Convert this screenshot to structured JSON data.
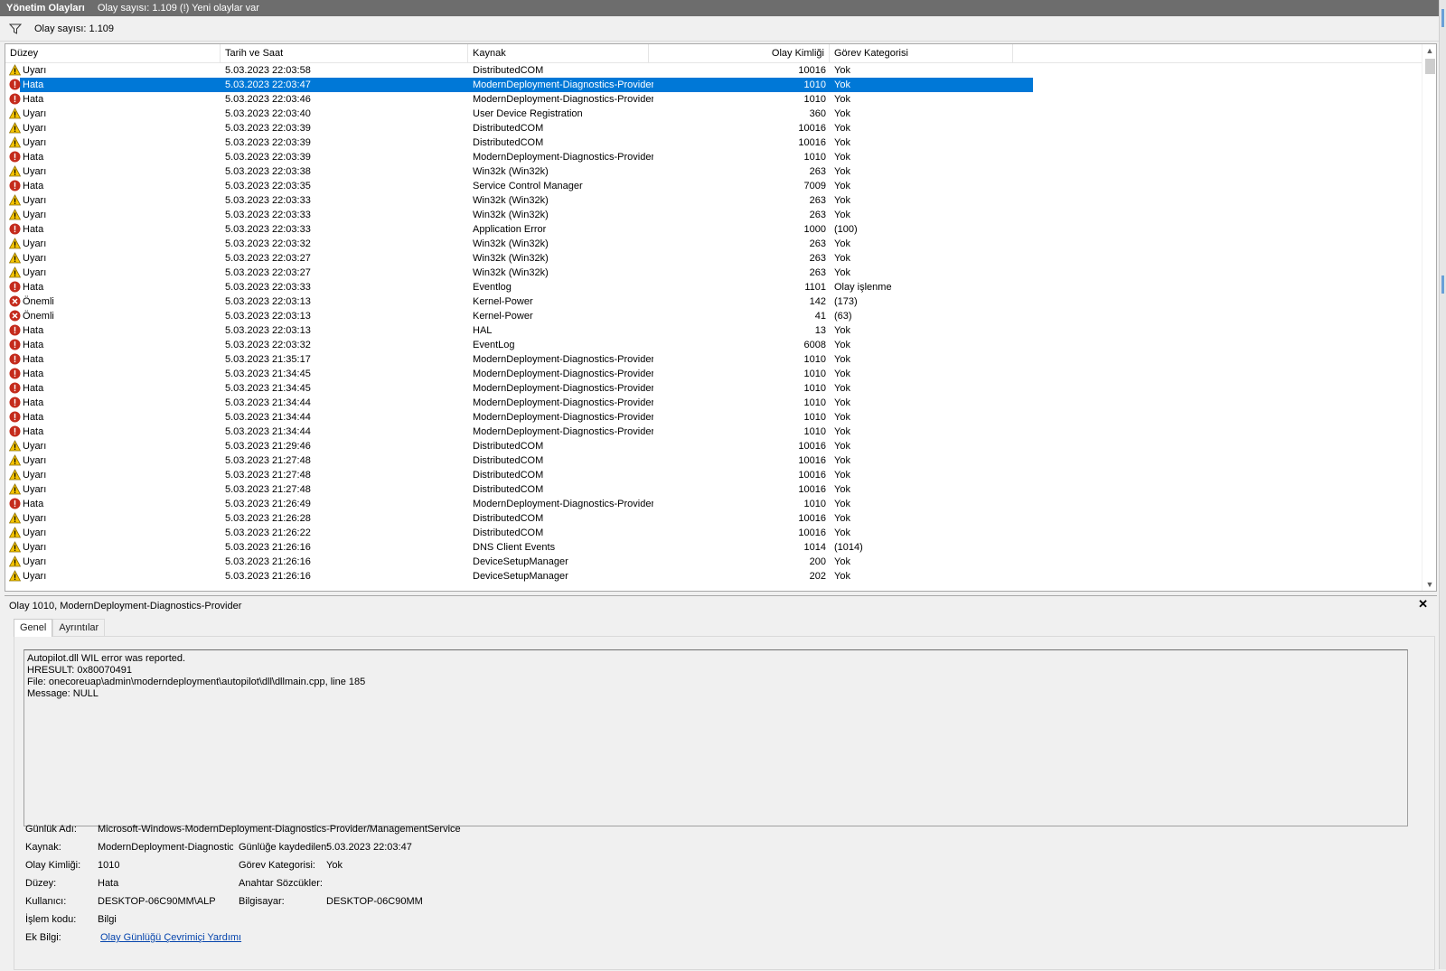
{
  "titlebar": {
    "title": "Yönetim Olayları",
    "subtitle": "Olay sayısı: 1.109 (!) Yeni olaylar var"
  },
  "filterbar": {
    "count_label": "Olay sayısı: 1.109",
    "icon": "filter-icon"
  },
  "columns": {
    "level": "Düzey",
    "date": "Tarih ve Saat",
    "source": "Kaynak",
    "event_id": "Olay Kimliği",
    "category": "Görev Kategorisi"
  },
  "colors": {
    "selection": "#0078d7",
    "warning": "#f5c400",
    "error": "#c42b1c",
    "link": "#0645ad"
  },
  "rows": [
    {
      "type": "warning",
      "level": "Uyarı",
      "date": "5.03.2023 22:03:58",
      "source": "DistributedCOM",
      "event_id": "10016",
      "category": "Yok"
    },
    {
      "type": "error",
      "level": "Hata",
      "date": "5.03.2023 22:03:47",
      "source": "ModernDeployment-Diagnostics-Provider",
      "event_id": "1010",
      "category": "Yok",
      "selected": true
    },
    {
      "type": "error",
      "level": "Hata",
      "date": "5.03.2023 22:03:46",
      "source": "ModernDeployment-Diagnostics-Provider",
      "event_id": "1010",
      "category": "Yok"
    },
    {
      "type": "warning",
      "level": "Uyarı",
      "date": "5.03.2023 22:03:40",
      "source": "User Device Registration",
      "event_id": "360",
      "category": "Yok"
    },
    {
      "type": "warning",
      "level": "Uyarı",
      "date": "5.03.2023 22:03:39",
      "source": "DistributedCOM",
      "event_id": "10016",
      "category": "Yok"
    },
    {
      "type": "warning",
      "level": "Uyarı",
      "date": "5.03.2023 22:03:39",
      "source": "DistributedCOM",
      "event_id": "10016",
      "category": "Yok"
    },
    {
      "type": "error",
      "level": "Hata",
      "date": "5.03.2023 22:03:39",
      "source": "ModernDeployment-Diagnostics-Provider",
      "event_id": "1010",
      "category": "Yok"
    },
    {
      "type": "warning",
      "level": "Uyarı",
      "date": "5.03.2023 22:03:38",
      "source": "Win32k (Win32k)",
      "event_id": "263",
      "category": "Yok"
    },
    {
      "type": "error",
      "level": "Hata",
      "date": "5.03.2023 22:03:35",
      "source": "Service Control Manager",
      "event_id": "7009",
      "category": "Yok"
    },
    {
      "type": "warning",
      "level": "Uyarı",
      "date": "5.03.2023 22:03:33",
      "source": "Win32k (Win32k)",
      "event_id": "263",
      "category": "Yok"
    },
    {
      "type": "warning",
      "level": "Uyarı",
      "date": "5.03.2023 22:03:33",
      "source": "Win32k (Win32k)",
      "event_id": "263",
      "category": "Yok"
    },
    {
      "type": "error",
      "level": "Hata",
      "date": "5.03.2023 22:03:33",
      "source": "Application Error",
      "event_id": "1000",
      "category": "(100)"
    },
    {
      "type": "warning",
      "level": "Uyarı",
      "date": "5.03.2023 22:03:32",
      "source": "Win32k (Win32k)",
      "event_id": "263",
      "category": "Yok"
    },
    {
      "type": "warning",
      "level": "Uyarı",
      "date": "5.03.2023 22:03:27",
      "source": "Win32k (Win32k)",
      "event_id": "263",
      "category": "Yok"
    },
    {
      "type": "warning",
      "level": "Uyarı",
      "date": "5.03.2023 22:03:27",
      "source": "Win32k (Win32k)",
      "event_id": "263",
      "category": "Yok"
    },
    {
      "type": "error",
      "level": "Hata",
      "date": "5.03.2023 22:03:33",
      "source": "Eventlog",
      "event_id": "1101",
      "category": "Olay işlenme"
    },
    {
      "type": "critical",
      "level": "Önemli",
      "date": "5.03.2023 22:03:13",
      "source": "Kernel-Power",
      "event_id": "142",
      "category": "(173)"
    },
    {
      "type": "critical",
      "level": "Önemli",
      "date": "5.03.2023 22:03:13",
      "source": "Kernel-Power",
      "event_id": "41",
      "category": "(63)"
    },
    {
      "type": "error",
      "level": "Hata",
      "date": "5.03.2023 22:03:13",
      "source": "HAL",
      "event_id": "13",
      "category": "Yok"
    },
    {
      "type": "error",
      "level": "Hata",
      "date": "5.03.2023 22:03:32",
      "source": "EventLog",
      "event_id": "6008",
      "category": "Yok"
    },
    {
      "type": "error",
      "level": "Hata",
      "date": "5.03.2023 21:35:17",
      "source": "ModernDeployment-Diagnostics-Provider",
      "event_id": "1010",
      "category": "Yok"
    },
    {
      "type": "error",
      "level": "Hata",
      "date": "5.03.2023 21:34:45",
      "source": "ModernDeployment-Diagnostics-Provider",
      "event_id": "1010",
      "category": "Yok"
    },
    {
      "type": "error",
      "level": "Hata",
      "date": "5.03.2023 21:34:45",
      "source": "ModernDeployment-Diagnostics-Provider",
      "event_id": "1010",
      "category": "Yok"
    },
    {
      "type": "error",
      "level": "Hata",
      "date": "5.03.2023 21:34:44",
      "source": "ModernDeployment-Diagnostics-Provider",
      "event_id": "1010",
      "category": "Yok"
    },
    {
      "type": "error",
      "level": "Hata",
      "date": "5.03.2023 21:34:44",
      "source": "ModernDeployment-Diagnostics-Provider",
      "event_id": "1010",
      "category": "Yok"
    },
    {
      "type": "error",
      "level": "Hata",
      "date": "5.03.2023 21:34:44",
      "source": "ModernDeployment-Diagnostics-Provider",
      "event_id": "1010",
      "category": "Yok"
    },
    {
      "type": "warning",
      "level": "Uyarı",
      "date": "5.03.2023 21:29:46",
      "source": "DistributedCOM",
      "event_id": "10016",
      "category": "Yok"
    },
    {
      "type": "warning",
      "level": "Uyarı",
      "date": "5.03.2023 21:27:48",
      "source": "DistributedCOM",
      "event_id": "10016",
      "category": "Yok"
    },
    {
      "type": "warning",
      "level": "Uyarı",
      "date": "5.03.2023 21:27:48",
      "source": "DistributedCOM",
      "event_id": "10016",
      "category": "Yok"
    },
    {
      "type": "warning",
      "level": "Uyarı",
      "date": "5.03.2023 21:27:48",
      "source": "DistributedCOM",
      "event_id": "10016",
      "category": "Yok"
    },
    {
      "type": "error",
      "level": "Hata",
      "date": "5.03.2023 21:26:49",
      "source": "ModernDeployment-Diagnostics-Provider",
      "event_id": "1010",
      "category": "Yok"
    },
    {
      "type": "warning",
      "level": "Uyarı",
      "date": "5.03.2023 21:26:28",
      "source": "DistributedCOM",
      "event_id": "10016",
      "category": "Yok"
    },
    {
      "type": "warning",
      "level": "Uyarı",
      "date": "5.03.2023 21:26:22",
      "source": "DistributedCOM",
      "event_id": "10016",
      "category": "Yok"
    },
    {
      "type": "warning",
      "level": "Uyarı",
      "date": "5.03.2023 21:26:16",
      "source": "DNS Client Events",
      "event_id": "1014",
      "category": "(1014)"
    },
    {
      "type": "warning",
      "level": "Uyarı",
      "date": "5.03.2023 21:26:16",
      "source": "DeviceSetupManager",
      "event_id": "200",
      "category": "Yok"
    },
    {
      "type": "warning",
      "level": "Uyarı",
      "date": "5.03.2023 21:26:16",
      "source": "DeviceSetupManager",
      "event_id": "202",
      "category": "Yok"
    }
  ],
  "detail": {
    "title": "Olay 1010, ModernDeployment-Diagnostics-Provider",
    "close_label": "✕",
    "tabs": [
      "Genel",
      "Ayrıntılar"
    ],
    "message_lines": [
      "Autopilot.dll WIL error was reported.",
      "HRESULT: 0x80070491",
      "File: onecoreuap\\admin\\moderndeployment\\autopilot\\dll\\dllmain.cpp, line 185",
      "Message: NULL"
    ],
    "props": {
      "log_name_label": "Günlük Adı:",
      "log_name": "Microsoft-Windows-ModernDeployment-Diagnostics-Provider/ManagementService",
      "source_label": "Kaynak:",
      "source": "ModernDeployment-Diagnostics-",
      "logged_label": "Günlüğe kaydedilen:",
      "logged": "5.03.2023 22:03:47",
      "event_id_label": "Olay Kimliği:",
      "event_id": "1010",
      "category_label": "Görev Kategorisi:",
      "category": "Yok",
      "level_label": "Düzey:",
      "level": "Hata",
      "keywords_label": "Anahtar Sözcükler:",
      "user_label": "Kullanıcı:",
      "user": "DESKTOP-06C90MM\\ALP",
      "computer_label": "Bilgisayar:",
      "computer": "DESKTOP-06C90MM",
      "opcode_label": "İşlem kodu:",
      "opcode": "Bilgi",
      "more_info_label": "Ek Bilgi:",
      "more_info_link": "Olay Günlüğü Çevrimiçi Yardımı"
    }
  }
}
